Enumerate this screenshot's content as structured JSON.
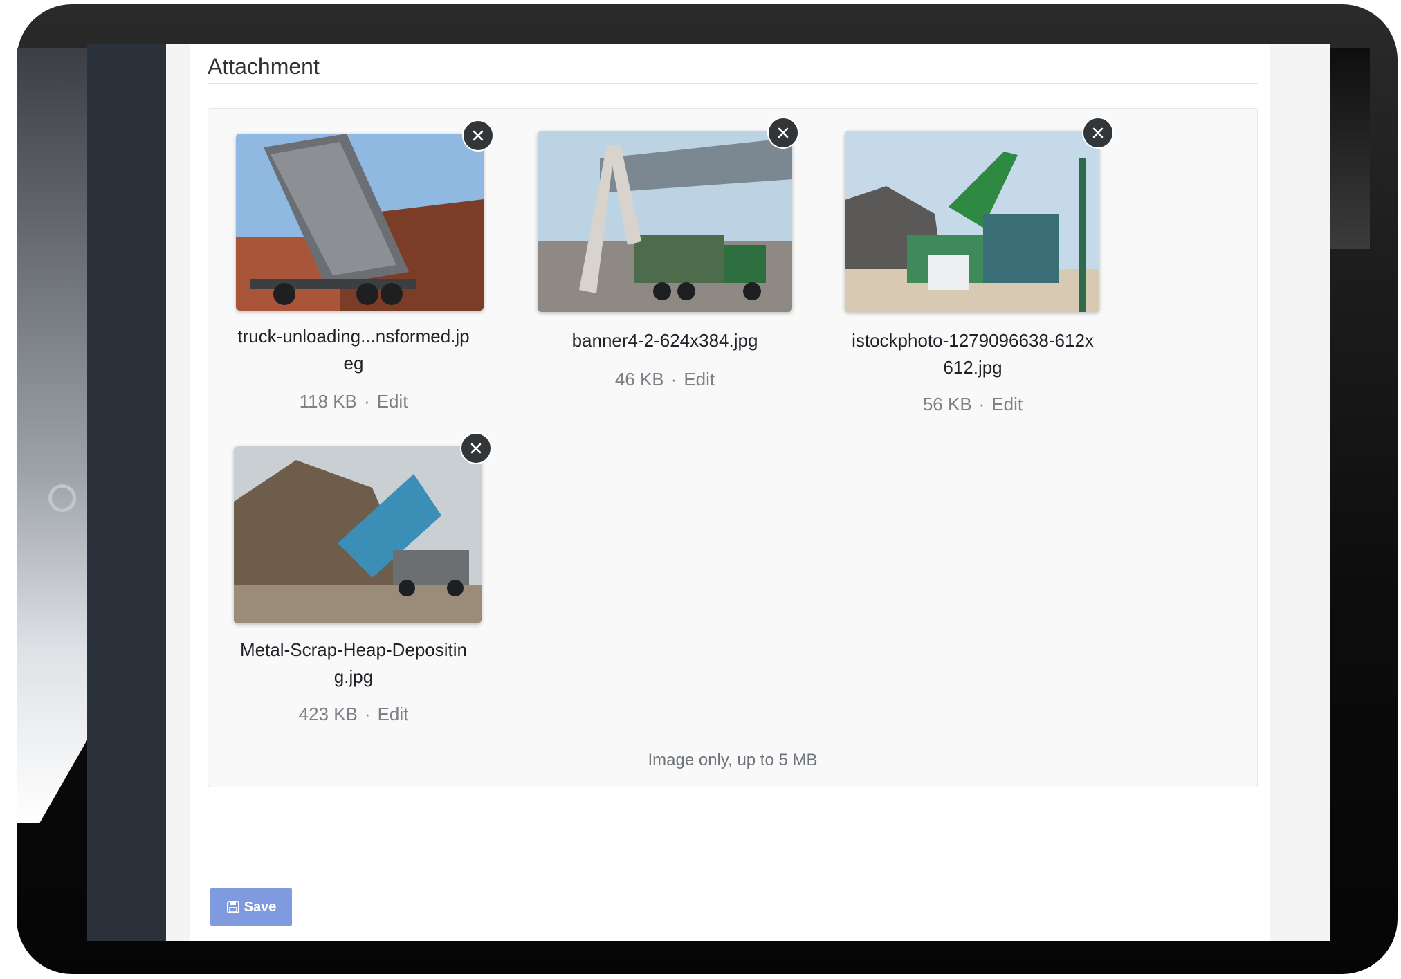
{
  "attachment": {
    "section_title": "Attachment",
    "hint": "Image only, up to 5 MB",
    "files": [
      {
        "name": "truck-unloading...nsformed.jpeg",
        "size": "118 KB",
        "separator": "·",
        "edit_label": "Edit",
        "remove_icon": "close-icon"
      },
      {
        "name": "banner4-2-624x384.jpg",
        "size": "46 KB",
        "separator": "·",
        "edit_label": "Edit",
        "remove_icon": "close-icon"
      },
      {
        "name": "istockphoto-1279096638-612x612.jpg",
        "size": "56 KB",
        "separator": "·",
        "edit_label": "Edit",
        "remove_icon": "close-icon"
      },
      {
        "name": "Metal-Scrap-Heap-Depositing.jpg",
        "size": "423 KB",
        "separator": "·",
        "edit_label": "Edit",
        "remove_icon": "close-icon"
      }
    ]
  },
  "actions": {
    "save_label": "Save",
    "save_icon": "floppy-disk-icon"
  },
  "colors": {
    "save_button": "#7f9ade",
    "sidebar": "#2b323b",
    "remove_button": "#333638"
  }
}
